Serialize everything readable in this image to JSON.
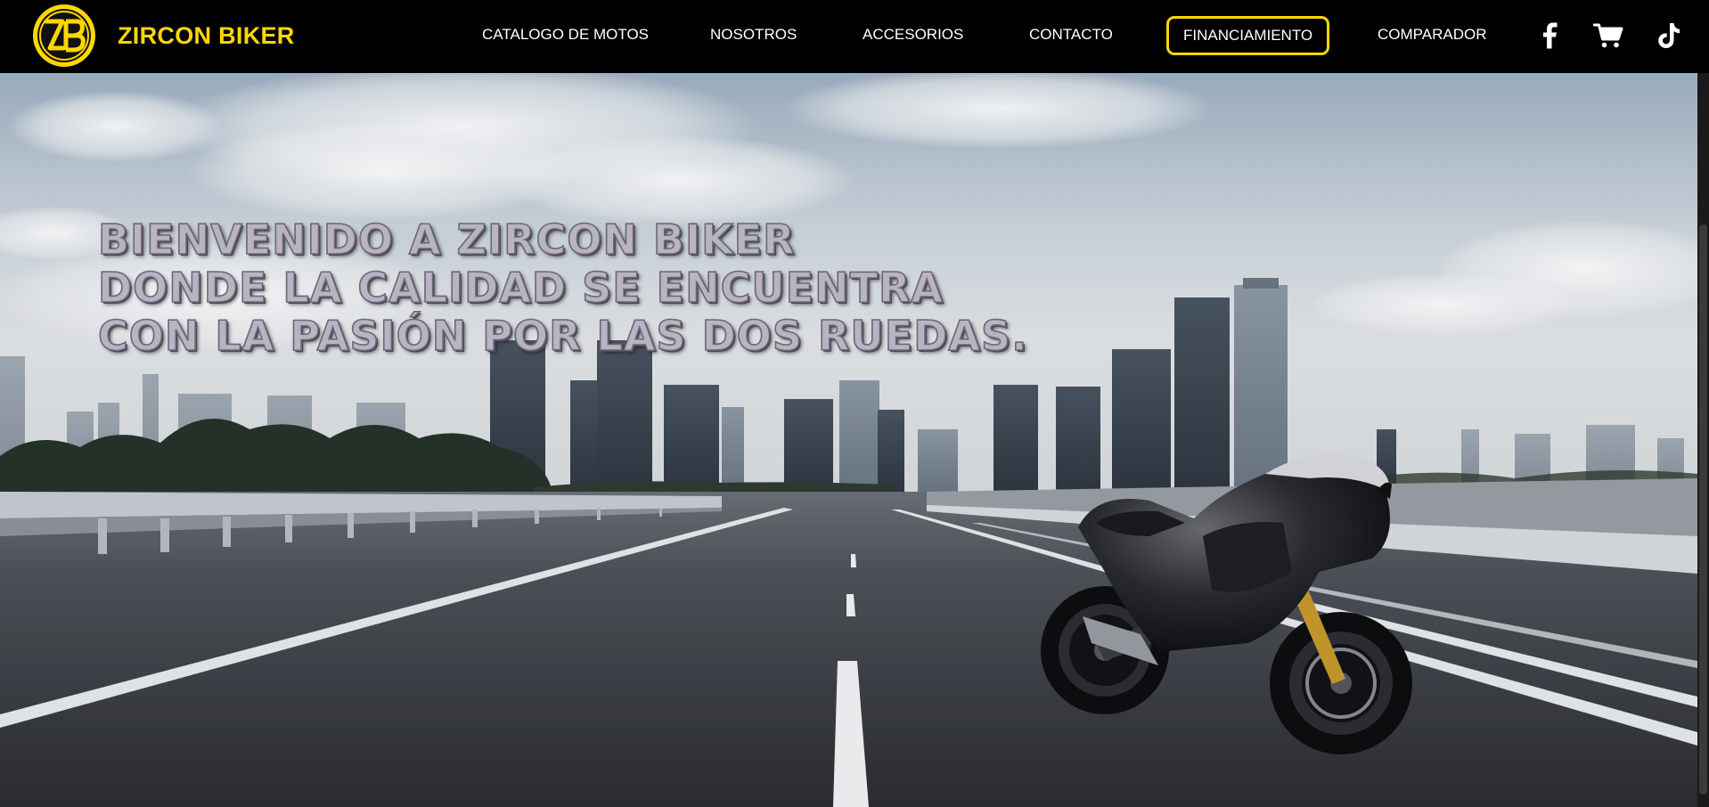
{
  "brand": {
    "logo_icon": "zb-monogram-icon",
    "name": "ZIRCON BIKER",
    "accent_color": "#ffd700"
  },
  "nav": {
    "items": [
      {
        "label": "CATALOGO DE MOTOS"
      },
      {
        "label": "NOSOTROS"
      },
      {
        "label": "ACCESORIOS"
      },
      {
        "label": "CONTACTO"
      },
      {
        "label": "FINANCIAMIENTO",
        "highlighted": true
      },
      {
        "label": "COMPARADOR"
      }
    ],
    "icons": [
      "facebook-icon",
      "cart-icon",
      "tiktok-icon"
    ]
  },
  "hero": {
    "headline_lines": [
      "BIENVENIDO A ZIRCON BIKER",
      "DONDE LA CALIDAD SE ENCUENTRA",
      "CON LA PASIÓN POR LAS DOS RUEDAS."
    ],
    "image_subject": "motorcycle-on-highway-city-skyline"
  }
}
